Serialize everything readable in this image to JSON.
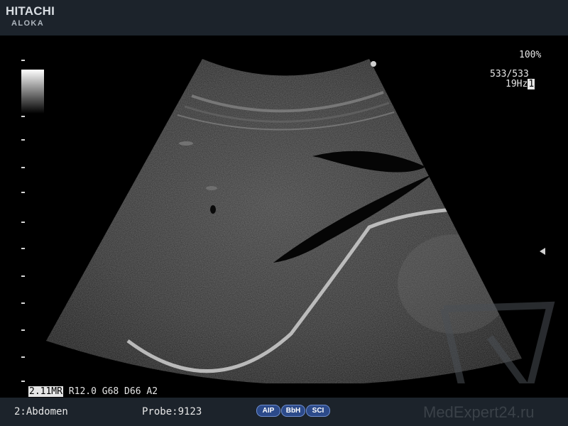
{
  "brand": {
    "name": "HITACHI",
    "sub": "ALOKA"
  },
  "display": {
    "zoom": "100%",
    "frames": "533/533",
    "frame_rate": "19Hz",
    "frame_rate_box": "1"
  },
  "params": {
    "mode": "2.11MR",
    "line": " R12.0 G68 D66 A2"
  },
  "footer": {
    "preset": "2:Abdomen",
    "probe": "Probe:9123",
    "buttons": [
      "AIP",
      "BbH",
      "SCI"
    ],
    "watermark": "MedExpert24.ru"
  },
  "colors": {
    "bar_bg": "#1c232b",
    "pill_bg": "#2c4a8a",
    "text": "#e6e6e6"
  },
  "icons": [
    "grayscale-bar",
    "focus-marker-icon",
    "watermark-logo-icon"
  ]
}
